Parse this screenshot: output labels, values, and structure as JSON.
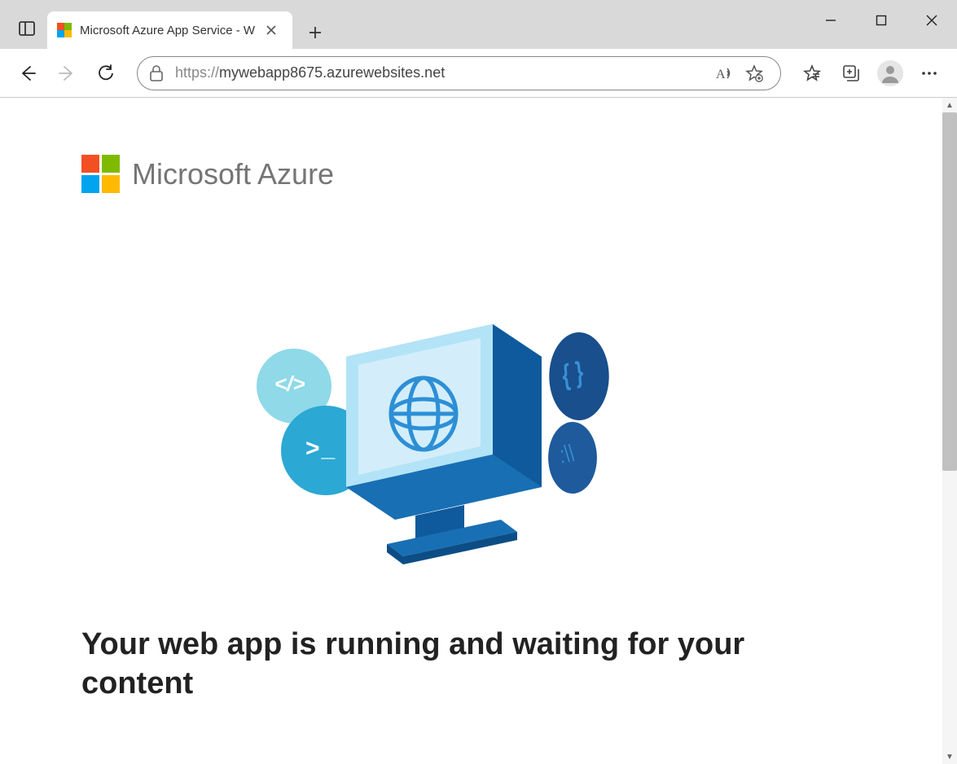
{
  "browser": {
    "tab_title": "Microsoft Azure App Service - W",
    "url_protocol": "https://",
    "url_host": "mywebapp8675.azurewebsites.net"
  },
  "page": {
    "brand": "Microsoft Azure",
    "headline": "Your web app is running and waiting for your content"
  },
  "colors": {
    "ms_red": "#f25022",
    "ms_green": "#7fba00",
    "ms_blue": "#00a4ef",
    "ms_yellow": "#ffb900"
  }
}
